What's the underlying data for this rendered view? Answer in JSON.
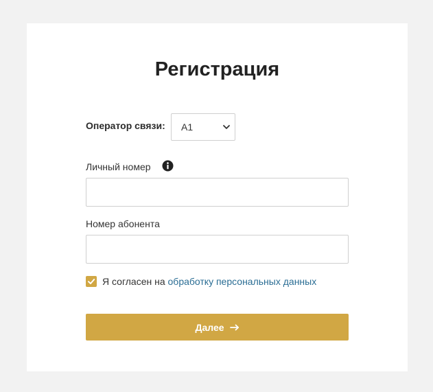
{
  "form": {
    "title": "Регистрация",
    "operator": {
      "label": "Оператор связи:",
      "selected": "A1",
      "icon": "chevron-down-icon"
    },
    "personal_number": {
      "label": "Личный номер",
      "value": "",
      "placeholder": "",
      "info_icon": "info-icon"
    },
    "subscriber_number": {
      "label": "Номер абонента",
      "value": "",
      "placeholder": ""
    },
    "consent": {
      "checked": true,
      "text": "Я согласен на",
      "link_text": "обработку персональных данных"
    },
    "submit": {
      "label": "Далее",
      "icon": "arrow-right-icon"
    }
  },
  "colors": {
    "accent": "#d1a744",
    "link": "#2a6d94",
    "background": "#f2f2f2",
    "card": "#ffffff"
  }
}
